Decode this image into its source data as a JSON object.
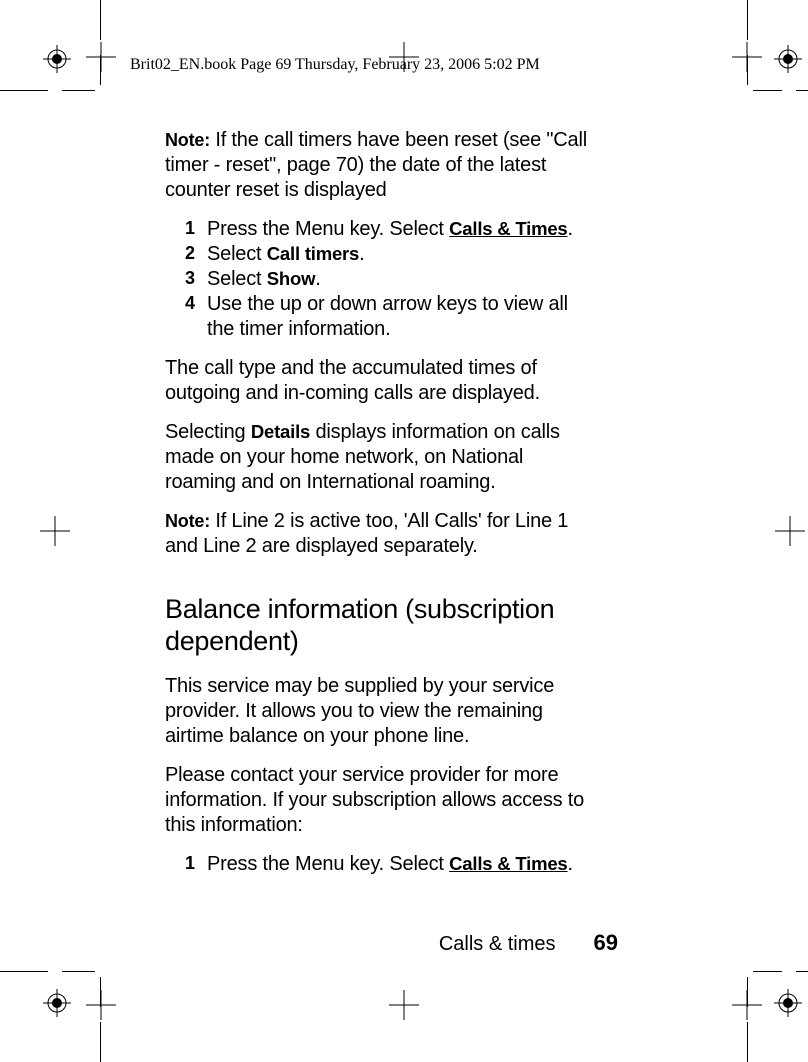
{
  "header": {
    "runningHead": "Brit02_EN.book  Page 69  Thursday, February 23, 2006  5:02 PM"
  },
  "body": {
    "note1_label": "Note:",
    "note1_text": " If the call timers have been reset (see \"Call timer - reset\", page 70) the date of the latest counter reset is displayed",
    "steps1": {
      "n1": "1",
      "t1a": "Press the Menu key. Select ",
      "t1b": "Calls & Times",
      "t1c": ".",
      "n2": "2",
      "t2a": "Select ",
      "t2b": "Call timers",
      "t2c": ".",
      "n3": "3",
      "t3a": "Select ",
      "t3b": "Show",
      "t3c": ".",
      "n4": "4",
      "t4": "Use the up or down arrow keys to view all the timer information."
    },
    "para2": "The call type and the accumulated times of outgoing and in-coming calls are displayed.",
    "para3a": "Selecting ",
    "para3b": "Details",
    "para3c": " displays information on calls made on your home network, on National roaming and on International roaming.",
    "note2_label": "Note:",
    "note2_text": " If Line 2 is active too, 'All Calls' for Line 1 and Line 2 are displayed separately.",
    "heading": "Balance information (subscription dependent)",
    "para4": "This service may be supplied by your service provider. It allows you to view the remaining airtime balance on your phone line.",
    "para5": "Please contact your service provider for more information. If your subscription allows access to this information:",
    "steps2": {
      "n1": "1",
      "t1a": "Press the Menu key. Select ",
      "t1b": "Calls & Times",
      "t1c": "."
    }
  },
  "footer": {
    "section": "Calls & times",
    "page": "69"
  }
}
